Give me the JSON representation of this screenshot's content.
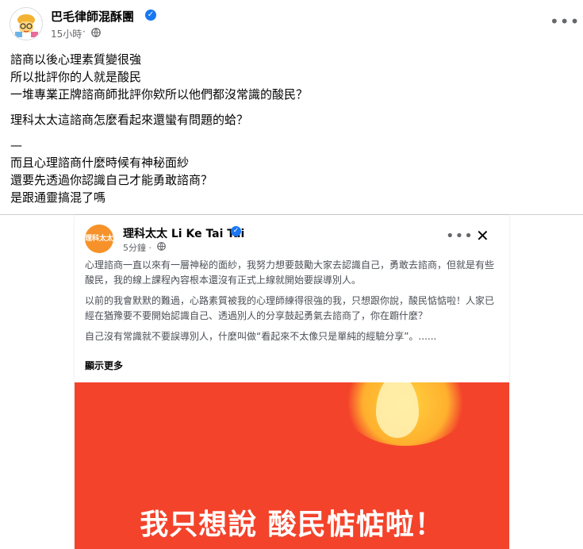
{
  "post": {
    "author": "巴毛律師混酥團",
    "time": "15小時",
    "separator": "·",
    "lines": [
      "諮商以後心理素質變很強",
      "所以批評你的人就是酸民",
      "一堆專業正牌諮商師批評你欸所以他們都沒常識的酸民？",
      "",
      "理科太太這諮商怎麼看起來還蠻有問題的蛤？",
      "",
      "—",
      "而且心理諮商什麼時候有神秘面紗",
      "還要先透過你認識自己才能勇敢諮商？",
      "是跟通靈搞混了嗎"
    ]
  },
  "shared": {
    "author": "理科太太 Li Ke Tai Tai",
    "time": "5分鐘",
    "separator": "·",
    "logo_text": "理科太太",
    "paragraphs": [
      "心理諮商一直以來有一層神秘的面紗，我努力想要鼓勵大家去認識自己，勇敢去諮商，但就是有些酸民，我的線上課程內容根本還沒有正式上線就開始要誤導別人。",
      "以前的我會默默的難過，心路素質被我的心理師練得很強的我，只想跟你說，酸民惦惦啦！人家已經在猶豫要不要開始認識自己、透過別人的分享鼓起勇氣去諮商了，你在躕什麼？",
      "自己沒有常識就不要誤導別人，什麼叫做“看起來不太像只是單純的經驗分享”。......"
    ],
    "see_more": "顯示更多",
    "image_caption": "我只想說 酸民惦惦啦！"
  },
  "colors": {
    "verified": "#1877f2",
    "hero_background": "#f4432b",
    "logo_background": "#f7922a"
  },
  "icons": [
    "verified-icon",
    "globe-icon",
    "more-icon",
    "close-icon"
  ]
}
